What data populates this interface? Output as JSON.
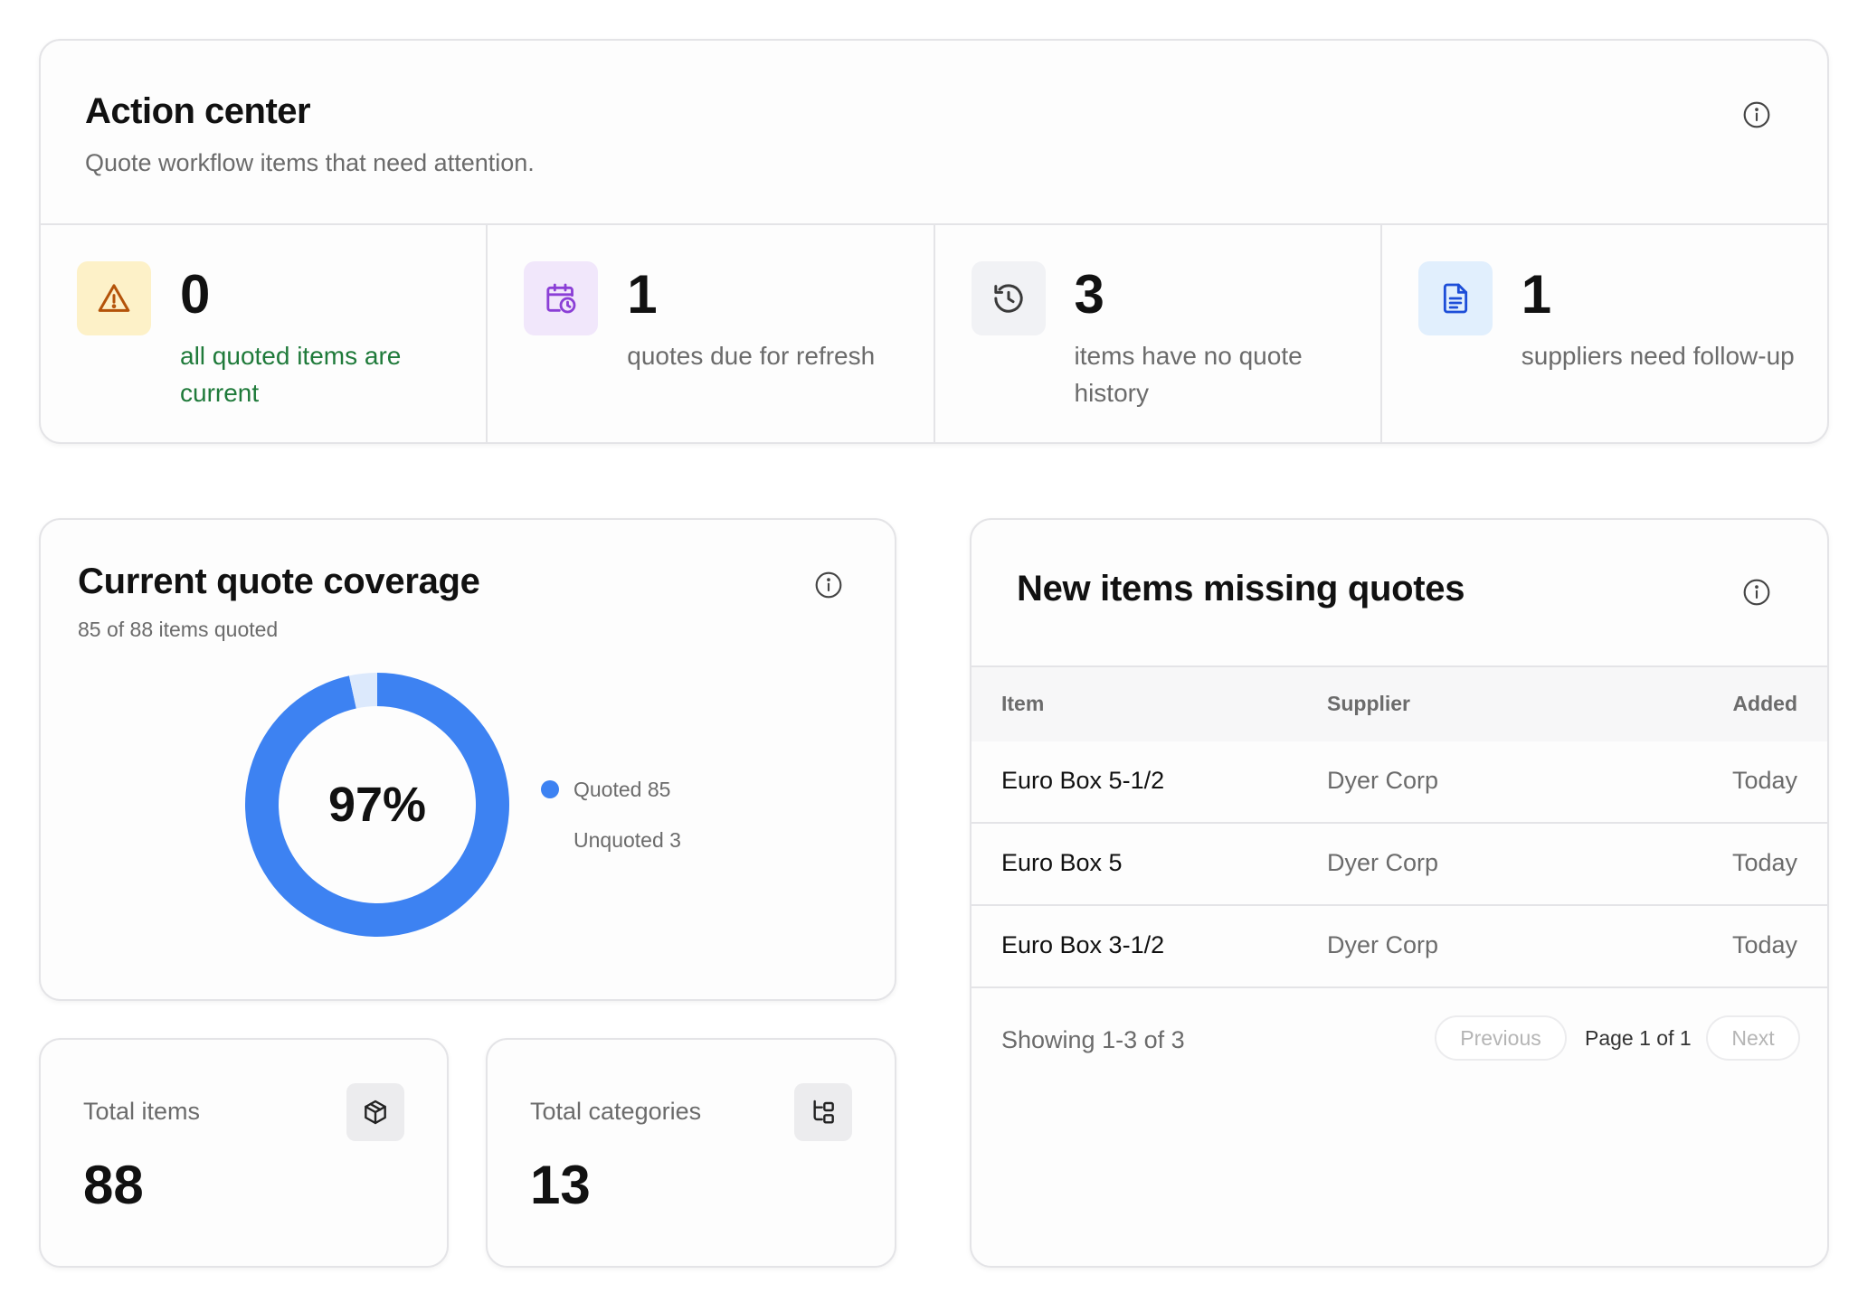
{
  "action_center": {
    "title": "Action center",
    "subtitle": "Quote workflow items that need attention.",
    "info_icon": "info-icon",
    "metrics": [
      {
        "value": "0",
        "label": "all quoted items are current",
        "icon": "warning-triangle-icon",
        "icon_bg": "#fdf1c8",
        "icon_color": "#b45309",
        "label_color": "#1f7a3a"
      },
      {
        "value": "1",
        "label": "quotes due for refresh",
        "icon": "calendar-clock-icon",
        "icon_bg": "#f1e7fb",
        "icon_color": "#8b3fd6",
        "label_color": "#6b6b6b"
      },
      {
        "value": "3",
        "label": "items have no quote history",
        "icon": "history-icon",
        "icon_bg": "#f1f2f5",
        "icon_color": "#3a3a3a",
        "label_color": "#6b6b6b"
      },
      {
        "value": "1",
        "label": "suppliers need follow-up",
        "icon": "document-icon",
        "icon_bg": "#e1effd",
        "icon_color": "#1d4ed8",
        "label_color": "#6b6b6b"
      }
    ]
  },
  "coverage": {
    "title": "Current quote coverage",
    "subtitle": "85 of 88 items quoted",
    "center_label": "97%",
    "info_icon": "info-icon",
    "legend": [
      {
        "label": "Quoted 85",
        "color": "#3d82f2"
      },
      {
        "label": "Unquoted 3",
        "color": "#dce9fc"
      }
    ]
  },
  "chart_data": {
    "type": "pie",
    "categories": [
      "Quoted",
      "Unquoted"
    ],
    "values": [
      85,
      3
    ],
    "colors": [
      "#3d82f2",
      "#dce9fc"
    ],
    "center_text": "97%",
    "title": "Current quote coverage",
    "legend_position": "right"
  },
  "stats": {
    "total_items": {
      "label": "Total items",
      "value": "88",
      "icon": "box-icon"
    },
    "total_categories": {
      "label": "Total categories",
      "value": "13",
      "icon": "category-tree-icon"
    }
  },
  "missing_quotes": {
    "title": "New items missing quotes",
    "info_icon": "info-icon",
    "columns": {
      "item": "Item",
      "supplier": "Supplier",
      "added": "Added"
    },
    "rows": [
      {
        "item": "Euro Box 5-1/2",
        "supplier": "Dyer Corp",
        "added": "Today"
      },
      {
        "item": "Euro Box 5",
        "supplier": "Dyer Corp",
        "added": "Today"
      },
      {
        "item": "Euro Box 3-1/2",
        "supplier": "Dyer Corp",
        "added": "Today"
      }
    ],
    "footer": {
      "showing": "Showing 1-3 of 3",
      "previous": "Previous",
      "page": "Page 1 of 1",
      "next": "Next"
    }
  }
}
